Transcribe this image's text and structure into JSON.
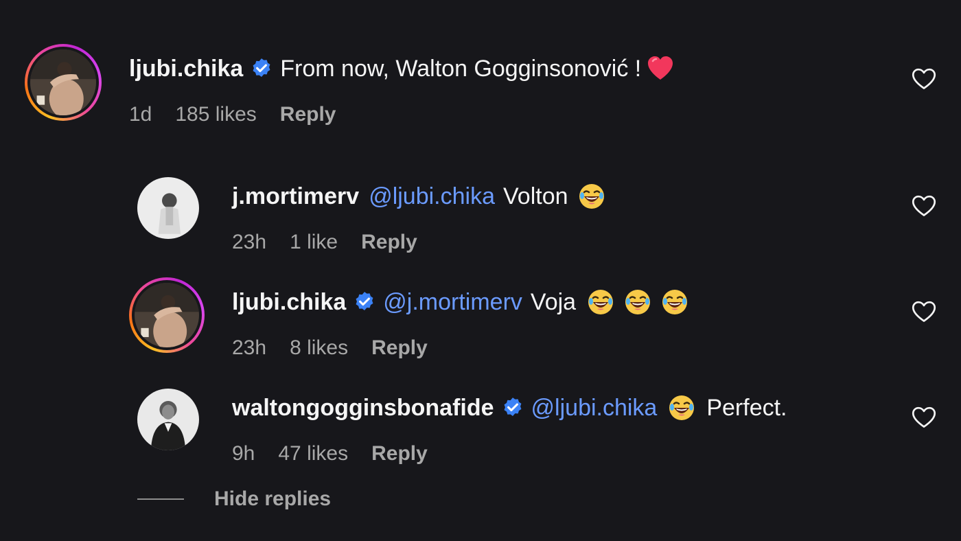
{
  "comments": [
    {
      "username": "ljubi.chika",
      "verified": true,
      "mention": "",
      "text": "From now, Walton Gogginsonović !",
      "trailing_emoji": "red-heart",
      "emoji_count": 0,
      "time": "1d",
      "likes": "185 likes",
      "reply_label": "Reply"
    },
    {
      "username": "j.mortimerv",
      "verified": false,
      "mention": "@ljubi.chika",
      "text": "Volton",
      "trailing_emoji": "laughing-face",
      "emoji_count": 1,
      "time": "23h",
      "likes": "1 like",
      "reply_label": "Reply"
    },
    {
      "username": "ljubi.chika",
      "verified": true,
      "mention": "@j.mortimerv",
      "text": "Voja",
      "trailing_emoji": "laughing-face",
      "emoji_count": 3,
      "time": "23h",
      "likes": "8 likes",
      "reply_label": "Reply"
    },
    {
      "username": "waltongogginsbonafide",
      "verified": true,
      "mention": "@ljubi.chika",
      "text": "Perfect.",
      "trailing_emoji": "laughing-face",
      "emoji_count": 1,
      "time": "9h",
      "likes": "47 likes",
      "reply_label": "Reply"
    }
  ],
  "hide_replies_label": "Hide replies",
  "colors": {
    "background": "#17171b",
    "mention": "#6b9bff",
    "verified": "#3b82f6",
    "meta": "#a8a8a8"
  },
  "icons": [
    "verified-badge-icon",
    "heart-outline-icon",
    "red-heart-emoji",
    "laughing-face-emoji"
  ]
}
